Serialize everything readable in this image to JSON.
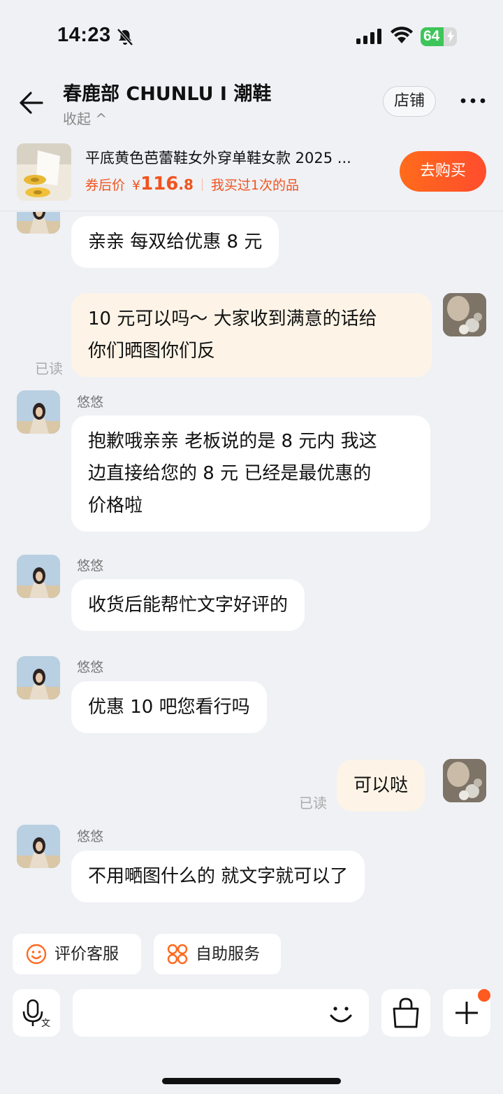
{
  "status_bar": {
    "time": "14:23",
    "battery": "64"
  },
  "header": {
    "shop_name": "春鹿部 CHUNLU I 潮鞋",
    "collapse_label": "收起 ^",
    "shop_button": "店铺"
  },
  "product": {
    "title": "平底黄色芭蕾鞋女外穿单鞋女款 2025 ...",
    "price_label": "券后价",
    "currency": "¥",
    "price_int": "116",
    "price_dec": ".8",
    "bought_text": "我买过1次的品",
    "buy_button": "去购买"
  },
  "messages": [
    {
      "from": "other",
      "text": "亲亲 每双给优惠 8 元"
    },
    {
      "from": "me",
      "text_lines": [
        "10 元可以吗～ 大家收到满意的话给",
        "你们晒图你们反"
      ],
      "read": "已读"
    },
    {
      "from": "other",
      "sender": "悠悠",
      "text_lines": [
        "抱歉哦亲亲 老板说的是 8 元内 我这",
        "边直接给您的 8 元 已经是最优惠的",
        "价格啦"
      ]
    },
    {
      "from": "other",
      "sender": "悠悠",
      "text": "收货后能帮忙文字好评的"
    },
    {
      "from": "other",
      "sender": "悠悠",
      "text": "优惠 10 吧您看行吗"
    },
    {
      "from": "me",
      "text": "可以哒",
      "read": "已读"
    },
    {
      "from": "other",
      "sender": "悠悠",
      "text": "不用嗮图什么的 就文字就可以了"
    }
  ],
  "quick_actions": {
    "rate_service": "评价客服",
    "self_service": "自助服务"
  },
  "input": {
    "placeholder": ""
  },
  "colors": {
    "accent": "#ff5a1f",
    "background": "#eff1f5",
    "my_bubble": "#fdf4e7"
  }
}
